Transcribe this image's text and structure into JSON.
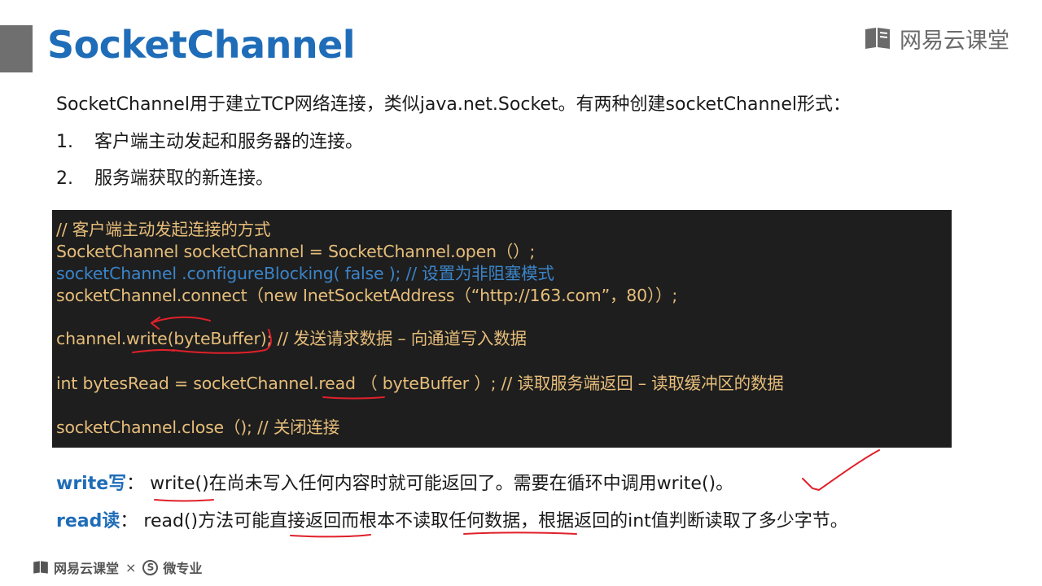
{
  "slide": {
    "title": "SocketChannel",
    "brand": "网易云课堂"
  },
  "intro": "SocketChannel用于建立TCP网络连接，类似java.net.Socket。有两种创建socketChannel形式：",
  "list": [
    {
      "num": "1.",
      "text": "客户端主动发起和服务器的连接。"
    },
    {
      "num": "2.",
      "text": "服务端获取的新连接。"
    }
  ],
  "code": {
    "lines": [
      "// 客户端主动发起连接的方式",
      "SocketChannel socketChannel = SocketChannel.open（）;",
      "socketChannel .configureBlocking( false ); // 设置为非阻塞模式",
      "socketChannel.connect（new InetSocketAddress（“http://163.com”，80））;",
      "channel.write(byteBuffer); //  发送请求数据 – 向通道写入数据",
      "int bytesRead = socketChannel.read （ byteBuffer ）; // 读取服务端返回 – 读取缓冲区的数据",
      "socketChannel.close（); // 关闭连接"
    ]
  },
  "notes": {
    "write_label": "write写",
    "write_colon": "：",
    "write_text": "write()在尚未写入任何内容时就可能返回了。需要在循环中调用write()。",
    "read_label": "read读",
    "read_colon": "：",
    "read_text": "read()方法可能直接返回而根本不读取任何数据，根据返回的int值判断读取了多少字节。"
  },
  "footer": {
    "brand": "网易云课堂",
    "times": "×",
    "coin_symbol": "S",
    "partner": "微专业"
  },
  "colors": {
    "title_blue": "#1f6db8",
    "code_bg": "#1e1e1e",
    "code_text": "#e6bd7a",
    "code_blue": "#3b84c8",
    "annotation_red": "#e0202a"
  },
  "icons": {
    "brand_logo": "book-icon",
    "footer_logo": "book-icon"
  }
}
